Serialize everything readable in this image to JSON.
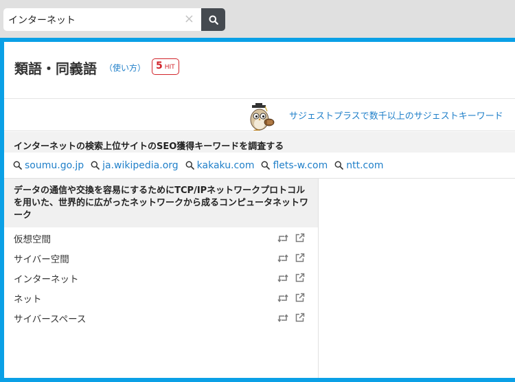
{
  "search": {
    "value": "インターネット",
    "clear_symbol": "×"
  },
  "header": {
    "title": "類語・同義語",
    "howto_link": "（使い方）",
    "hit_count": "5",
    "hit_label": "HIT"
  },
  "promo": {
    "text": "サジェストプラスで数千以上のサジェストキーワード"
  },
  "seo": {
    "title": "インターネットの検索上位サイトのSEO獲得キーワードを調査する",
    "sites": [
      "soumu.go.jp",
      "ja.wikipedia.org",
      "kakaku.com",
      "flets-w.com",
      "ntt.com"
    ]
  },
  "definition": {
    "text": "データの通信や交換を容易にするためにTCP/IPネットワークプロトコルを用いた、世界的に広がったネットワークから成るコンピュータネットワーク",
    "words": [
      "仮想空間",
      "サイバー空間",
      "インターネット",
      "ネット",
      "サイバースペース"
    ]
  },
  "colors": {
    "accent": "#0aa0e6",
    "link": "#1f7fc9",
    "badge": "#d1232a",
    "search_button": "#454a50"
  },
  "icons": {
    "search_button": "search-icon",
    "site": "search-icon",
    "swap": "retweet-icon",
    "external": "external-link-icon"
  }
}
